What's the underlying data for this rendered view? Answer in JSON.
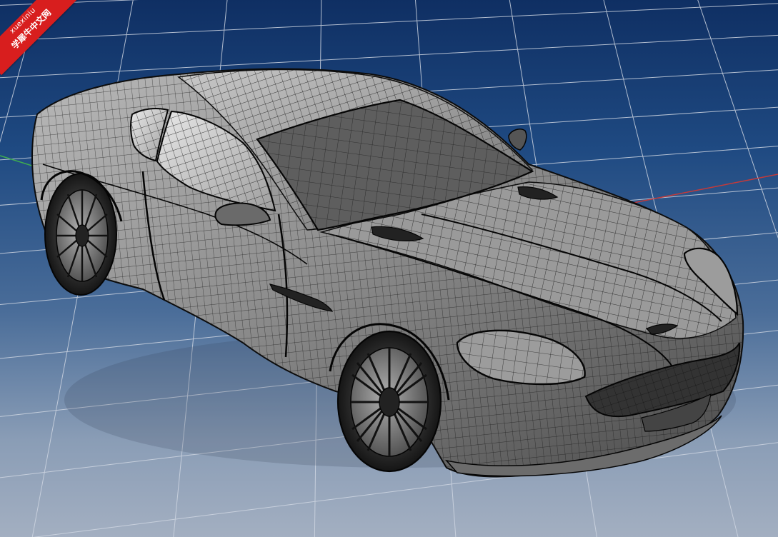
{
  "viewport": {
    "view": "perspective",
    "display_mode": "wireframe-over-shaded",
    "background_top_color": "#0f2f63",
    "background_bottom_color": "#a3afc1",
    "grid_color": "#cfd6e2",
    "x_axis_color": "#c43a3a",
    "y_axis_color": "#3fae4f",
    "model_fill_color": "#8e8e8e",
    "wire_color": "#111111"
  },
  "watermark": {
    "line1": "xuexiniu",
    "line2": "学犀牛中文网",
    "color": "#d81e1e"
  },
  "model": {
    "icon": "car-wireframe-icon"
  }
}
